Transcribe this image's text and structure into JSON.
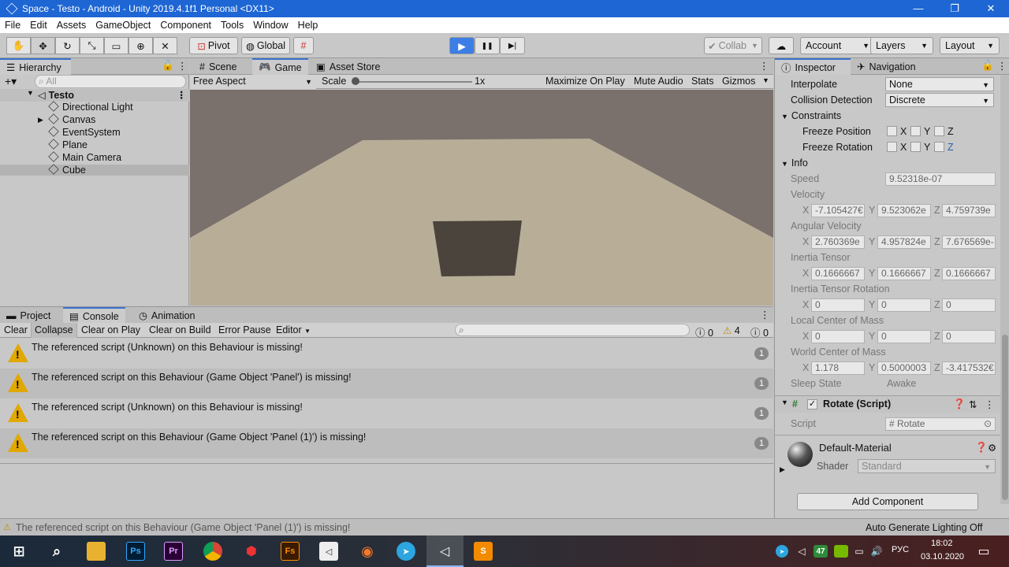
{
  "window": {
    "title": "Space - Testo - Android - Unity 2019.4.1f1 Personal <DX11>",
    "min": "—",
    "max": "❐",
    "close": "✕"
  },
  "menu": [
    "File",
    "Edit",
    "Assets",
    "GameObject",
    "Component",
    "Tools",
    "Window",
    "Help"
  ],
  "toolbar": {
    "pivot": "Pivot",
    "global": "Global",
    "collab": "Collab",
    "account": "Account",
    "layers": "Layers",
    "layout": "Layout",
    "play": "▶",
    "pause": "❚❚",
    "step": "▶|"
  },
  "hierarchy": {
    "tab": "Hierarchy",
    "search_placeholder": "All",
    "scene": "Testo",
    "items": [
      "Directional Light",
      "Canvas",
      "EventSystem",
      "Plane",
      "Main Camera",
      "Cube"
    ]
  },
  "scene_tabs": {
    "scene": "Scene",
    "game": "Game",
    "store": "Asset Store"
  },
  "game_bar": {
    "aspect": "Free Aspect",
    "scale": "Scale",
    "scale_value": "1x",
    "maximize": "Maximize On Play",
    "mute": "Mute Audio",
    "stats": "Stats",
    "gizmos": "Gizmos"
  },
  "bottom_tabs": {
    "project": "Project",
    "console": "Console",
    "animation": "Animation"
  },
  "console_bar": {
    "clear": "Clear",
    "collapse": "Collapse",
    "clear_play": "Clear on Play",
    "clear_build": "Clear on Build",
    "error_pause": "Error Pause",
    "editor": "Editor",
    "logs": "0",
    "warnings": "4",
    "errors": "0"
  },
  "console_messages": [
    {
      "text": "The referenced script (Unknown) on this Behaviour is missing!",
      "count": "1"
    },
    {
      "text": "The referenced script on this Behaviour (Game Object 'Panel') is missing!",
      "count": "1"
    },
    {
      "text": "The referenced script (Unknown) on this Behaviour is missing!",
      "count": "1"
    },
    {
      "text": "The referenced script on this Behaviour (Game Object 'Panel (1)') is missing!",
      "count": "1"
    }
  ],
  "inspector": {
    "tab": "Inspector",
    "nav_tab": "Navigation",
    "interpolate": "Interpolate",
    "interpolate_val": "None",
    "collision": "Collision Detection",
    "collision_val": "Discrete",
    "constraints": "Constraints",
    "freeze_pos": "Freeze Position",
    "freeze_rot": "Freeze Rotation",
    "x": "X",
    "y": "Y",
    "z": "Z",
    "info": "Info",
    "speed": "Speed",
    "speed_val": "9.52318e-07",
    "velocity": "Velocity",
    "vel": [
      "-7.105427€",
      "9.523062e",
      "4.759739e"
    ],
    "ang_vel": "Angular Velocity",
    "av": [
      "2.760369e",
      "4.957824e",
      "7.676569e-"
    ],
    "inertia": "Inertia Tensor",
    "it": [
      "0.1666667",
      "0.1666667",
      "0.1666667"
    ],
    "inertia_rot": "Inertia Tensor Rotation",
    "itr": [
      "0",
      "0",
      "0"
    ],
    "lcom": "Local Center of Mass",
    "lc": [
      "0",
      "0",
      "0"
    ],
    "wcom": "World Center of Mass",
    "wc": [
      "1.178",
      "0.500000З",
      "-3.417532€"
    ],
    "sleep": "Sleep State",
    "sleep_val": "Awake",
    "rotate": "Rotate (Script)",
    "script": "Script",
    "script_val": "Rotate",
    "material": "Default-Material",
    "shader": "Shader",
    "shader_val": "Standard",
    "add_component": "Add Component"
  },
  "status": {
    "message": "The referenced script on this Behaviour (Game Object 'Panel (1)') is missing!",
    "lighting": "Auto Generate Lighting Off"
  },
  "taskbar": {
    "lang": "РУС",
    "time": "18:02",
    "date": "03.10.2020",
    "badge": "47"
  }
}
